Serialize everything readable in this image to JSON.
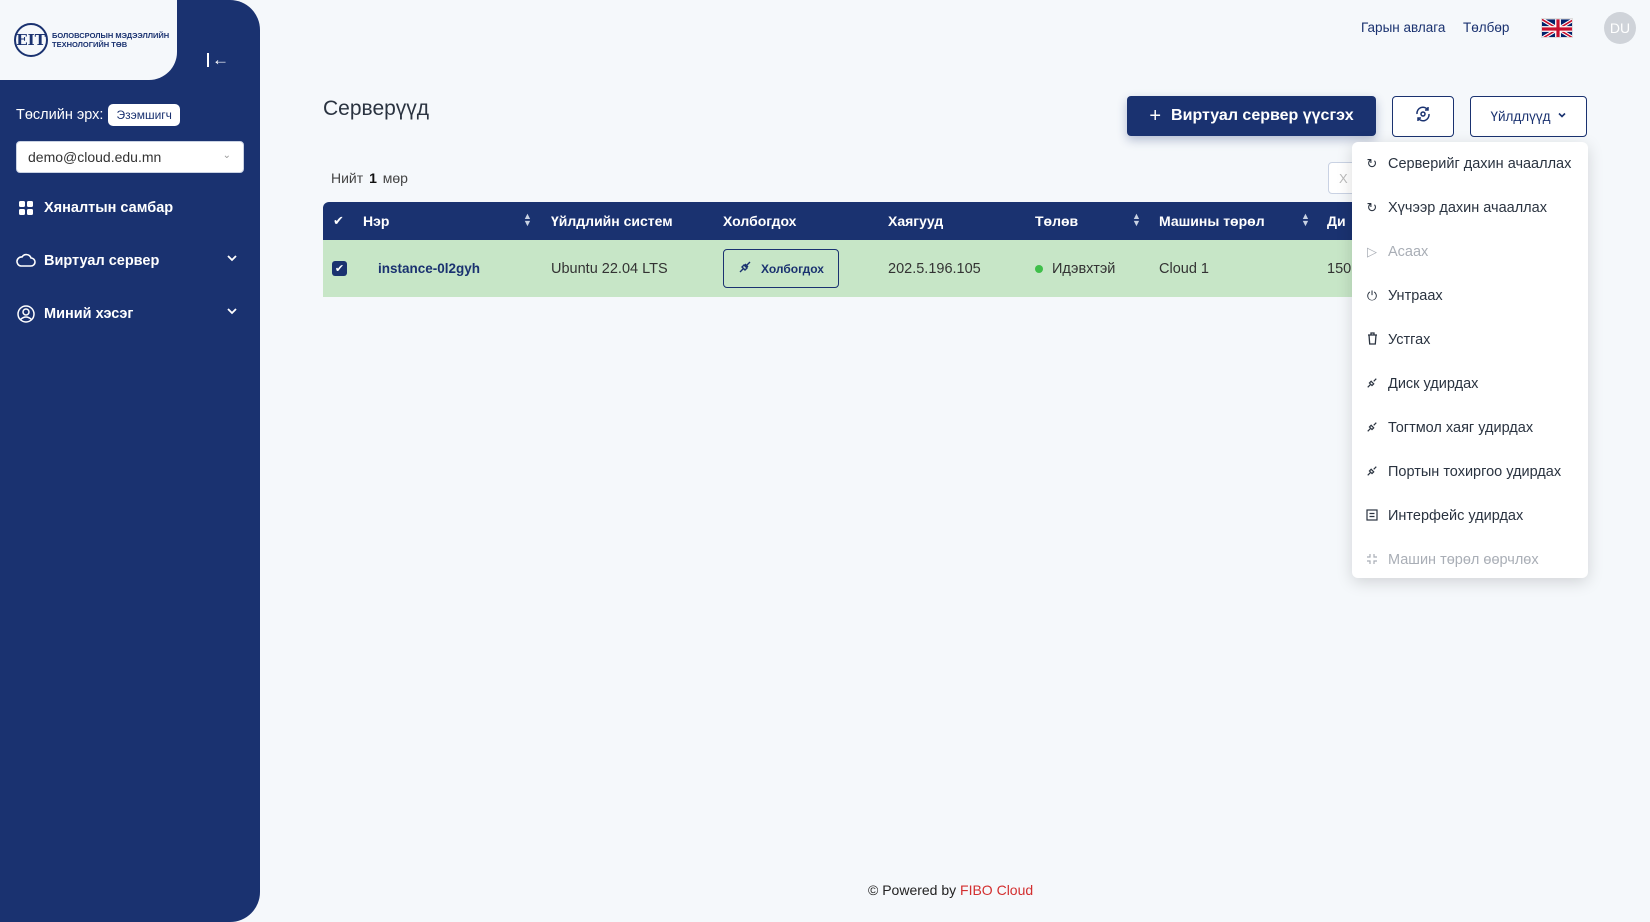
{
  "header": {
    "manual_link": "Гарын авлага",
    "payment_link": "Төлбөр",
    "avatar_initials": "DU"
  },
  "logo": {
    "mark": "ЕIТ",
    "line1": "БОЛОВСРОЛЫН МЭДЭЭЛЛИЙН",
    "line2": "ТЕХНОЛОГИЙН ТӨВ"
  },
  "sidebar": {
    "role_label": "Төслийн эрх:",
    "role_badge": "Эзэмшигч",
    "account": "demo@cloud.edu.mn",
    "items": [
      {
        "label": "Хяналтын самбар",
        "icon": "dashboard-icon"
      },
      {
        "label": "Виртуал сервер",
        "icon": "cloud-icon"
      },
      {
        "label": "Миний хэсэг",
        "icon": "user-circle-icon"
      }
    ]
  },
  "page": {
    "title": "Серверүүд",
    "create_button": "Виртуал сервер үүсгэх",
    "actions_button": "Үйлдлүүд",
    "total_prefix": "Нийт",
    "total_count": "1",
    "total_suffix": "мөр",
    "search_placeholder": "Х"
  },
  "table": {
    "columns": [
      "Нэр",
      "Үйлдлийн систем",
      "Холбогдох",
      "Хаягууд",
      "Төлөв",
      "Машины төрөл",
      "Ди"
    ],
    "rows": [
      {
        "name": "instance-0l2gyh",
        "os": "Ubuntu 22.04 LTS",
        "connect_label": "Холбогдох",
        "address": "202.5.196.105",
        "status": "Идэвхтэй",
        "machine_type": "Cloud 1",
        "disk": "150"
      }
    ]
  },
  "dropdown": {
    "items": [
      {
        "label": "Серверийг дахин ачааллах",
        "icon": "refresh-icon",
        "disabled": false
      },
      {
        "label": "Хүчээр дахин ачааллах",
        "icon": "refresh-icon",
        "disabled": false
      },
      {
        "label": "Асаах",
        "icon": "play-icon",
        "disabled": true
      },
      {
        "label": "Унтраах",
        "icon": "power-icon",
        "disabled": false
      },
      {
        "label": "Устгах",
        "icon": "trash-icon",
        "disabled": false
      },
      {
        "label": "Диск удирдах",
        "icon": "link-icon",
        "disabled": false
      },
      {
        "label": "Тогтмол хаяг удирдах",
        "icon": "link-icon",
        "disabled": false
      },
      {
        "label": "Портын тохиргоо удирдах",
        "icon": "link-icon",
        "disabled": false
      },
      {
        "label": "Интерфейс удирдах",
        "icon": "interface-icon",
        "disabled": false
      },
      {
        "label": "Машин төрөл өөрчлөх",
        "icon": "resize-icon",
        "disabled": true
      }
    ]
  },
  "footer": {
    "prefix": "© Powered by",
    "brand": "FIBO Cloud"
  },
  "colors": {
    "primary": "#1a3270",
    "row_selected": "#c7e6c7",
    "status_active": "#3fbf4a",
    "brand_red": "#d32f2f"
  }
}
